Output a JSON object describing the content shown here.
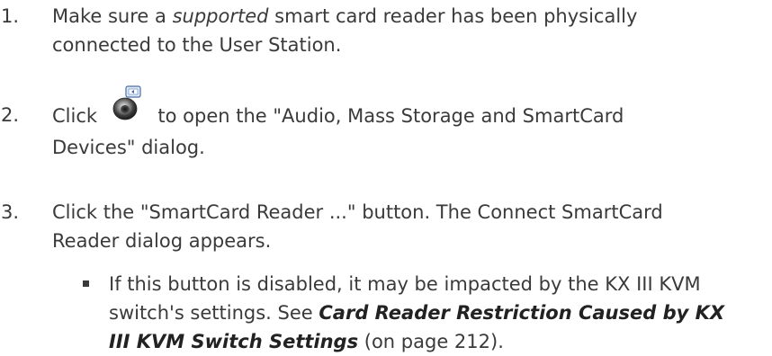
{
  "steps": [
    {
      "number": "1.",
      "line1_pre": "Make sure a ",
      "line1_em": "supported",
      "line1_post": " smart card reader has been physically",
      "line2": "connected to the User Station."
    },
    {
      "number": "2.",
      "pre": "Click",
      "icon": "audio-smartcard-devices-icon",
      "line1_post": "to open the \"Audio, Mass Storage and SmartCard",
      "line2": "Devices\" dialog."
    },
    {
      "number": "3.",
      "line1": "Click the \"SmartCard Reader ...\" button. The Connect SmartCard",
      "line2": "Reader dialog appears."
    }
  ],
  "note": {
    "line1": "If this button is disabled, it may be impacted by the KX III KVM",
    "line2_pre": "switch's settings. See ",
    "link_part1": "Card Reader Restriction Caused by KX",
    "link_part2": "III KVM Switch Settings",
    "line3_post": " (on page 212)."
  }
}
